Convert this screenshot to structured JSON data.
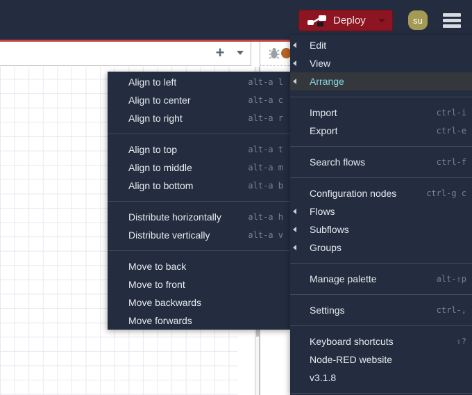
{
  "header": {
    "deploy_button": {
      "label": "Deploy"
    },
    "user_avatar": {
      "initials": "su"
    }
  },
  "workspace": {
    "tabbar": {
      "add_flow_tooltip": "+"
    }
  },
  "main_menu": {
    "items": [
      {
        "type": "item",
        "label": "Edit",
        "submenu": true
      },
      {
        "type": "item",
        "label": "View",
        "submenu": true
      },
      {
        "type": "item",
        "label": "Arrange",
        "submenu": true,
        "active": true
      },
      {
        "type": "sep"
      },
      {
        "type": "item",
        "label": "Import",
        "shortcut": "ctrl-i"
      },
      {
        "type": "item",
        "label": "Export",
        "shortcut": "ctrl-e"
      },
      {
        "type": "sep"
      },
      {
        "type": "item",
        "label": "Search flows",
        "shortcut": "ctrl-f"
      },
      {
        "type": "sep"
      },
      {
        "type": "item",
        "label": "Configuration nodes",
        "shortcut": "ctrl-g c"
      },
      {
        "type": "item",
        "label": "Flows",
        "submenu": true
      },
      {
        "type": "item",
        "label": "Subflows",
        "submenu": true
      },
      {
        "type": "item",
        "label": "Groups",
        "submenu": true
      },
      {
        "type": "sep"
      },
      {
        "type": "item",
        "label": "Manage palette",
        "shortcut": "alt-⇧p"
      },
      {
        "type": "sep"
      },
      {
        "type": "item",
        "label": "Settings",
        "shortcut": "ctrl-,"
      },
      {
        "type": "sep"
      },
      {
        "type": "item",
        "label": "Keyboard shortcuts",
        "shortcut": "⇧?"
      },
      {
        "type": "item",
        "label": "Node-RED website"
      },
      {
        "type": "item",
        "label": "v3.1.8"
      },
      {
        "type": "sep"
      }
    ]
  },
  "arrange_submenu": {
    "items": [
      {
        "type": "item",
        "label": "Align to left",
        "shortcut": "alt-a l"
      },
      {
        "type": "item",
        "label": "Align to center",
        "shortcut": "alt-a c"
      },
      {
        "type": "item",
        "label": "Align to right",
        "shortcut": "alt-a r"
      },
      {
        "type": "sep"
      },
      {
        "type": "item",
        "label": "Align to top",
        "shortcut": "alt-a t"
      },
      {
        "type": "item",
        "label": "Align to middle",
        "shortcut": "alt-a m"
      },
      {
        "type": "item",
        "label": "Align to bottom",
        "shortcut": "alt-a b"
      },
      {
        "type": "sep"
      },
      {
        "type": "item",
        "label": "Distribute horizontally",
        "shortcut": "alt-a h"
      },
      {
        "type": "item",
        "label": "Distribute vertically",
        "shortcut": "alt-a v"
      },
      {
        "type": "sep"
      },
      {
        "type": "item",
        "label": "Move to back"
      },
      {
        "type": "item",
        "label": "Move to front"
      },
      {
        "type": "item",
        "label": "Move backwards"
      },
      {
        "type": "item",
        "label": "Move forwards"
      }
    ]
  },
  "icons": {
    "deploy_icon": "node-wire-deploy",
    "hamburger_icon": "three-bars",
    "plus_icon": "+",
    "chevron_down_icon": "▾",
    "submenu_arrow_icon": "◂",
    "bug_icon": "debug-bug"
  },
  "colors": {
    "header_bg": "#232d3f",
    "accent_red_line": "#c34543",
    "deploy_bg": "#8c1521",
    "avatar_bg": "#a59a55",
    "menu_bg": "#232d3f",
    "menu_highlight_bg": "#34383d",
    "menu_highlight_text": "#86d7e3",
    "menu_separator": "#414b58",
    "shortcut_text": "#7b8290",
    "grid_line": "#e8e8f1"
  }
}
